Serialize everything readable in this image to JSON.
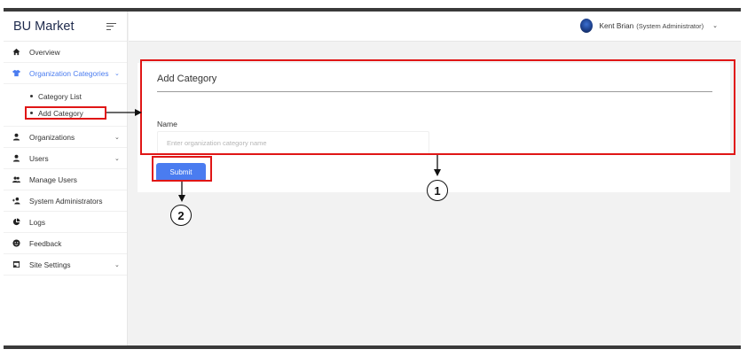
{
  "sidebar": {
    "brand": "BU Market",
    "items": [
      {
        "label": "Overview",
        "icon": "home-icon"
      },
      {
        "label": "Organization Categories",
        "icon": "shirt-icon",
        "active": true,
        "expanded": true,
        "children": [
          {
            "label": "Category List"
          },
          {
            "label": "Add Category"
          }
        ]
      },
      {
        "label": "Organizations",
        "icon": "person-icon",
        "has_chevron": true
      },
      {
        "label": "Users",
        "icon": "person-icon",
        "has_chevron": true
      },
      {
        "label": "Manage Users",
        "icon": "people-icon"
      },
      {
        "label": "System Administrators",
        "icon": "person-add-icon"
      },
      {
        "label": "Logs",
        "icon": "pie-chart-icon"
      },
      {
        "label": "Feedback",
        "icon": "smiley-icon"
      },
      {
        "label": "Site Settings",
        "icon": "window-icon",
        "has_chevron": true
      }
    ],
    "chevron": "⌄"
  },
  "topbar": {
    "user_name": "Kent Brian",
    "user_role": "(System Administrator)",
    "caret": "⌄"
  },
  "form": {
    "title": "Add Category",
    "name_label": "Name",
    "name_placeholder": "Enter organization category name",
    "name_value": "",
    "submit_label": "Submit"
  },
  "annotations": {
    "callout_1": "1",
    "callout_2": "2",
    "color": "#e01616"
  }
}
